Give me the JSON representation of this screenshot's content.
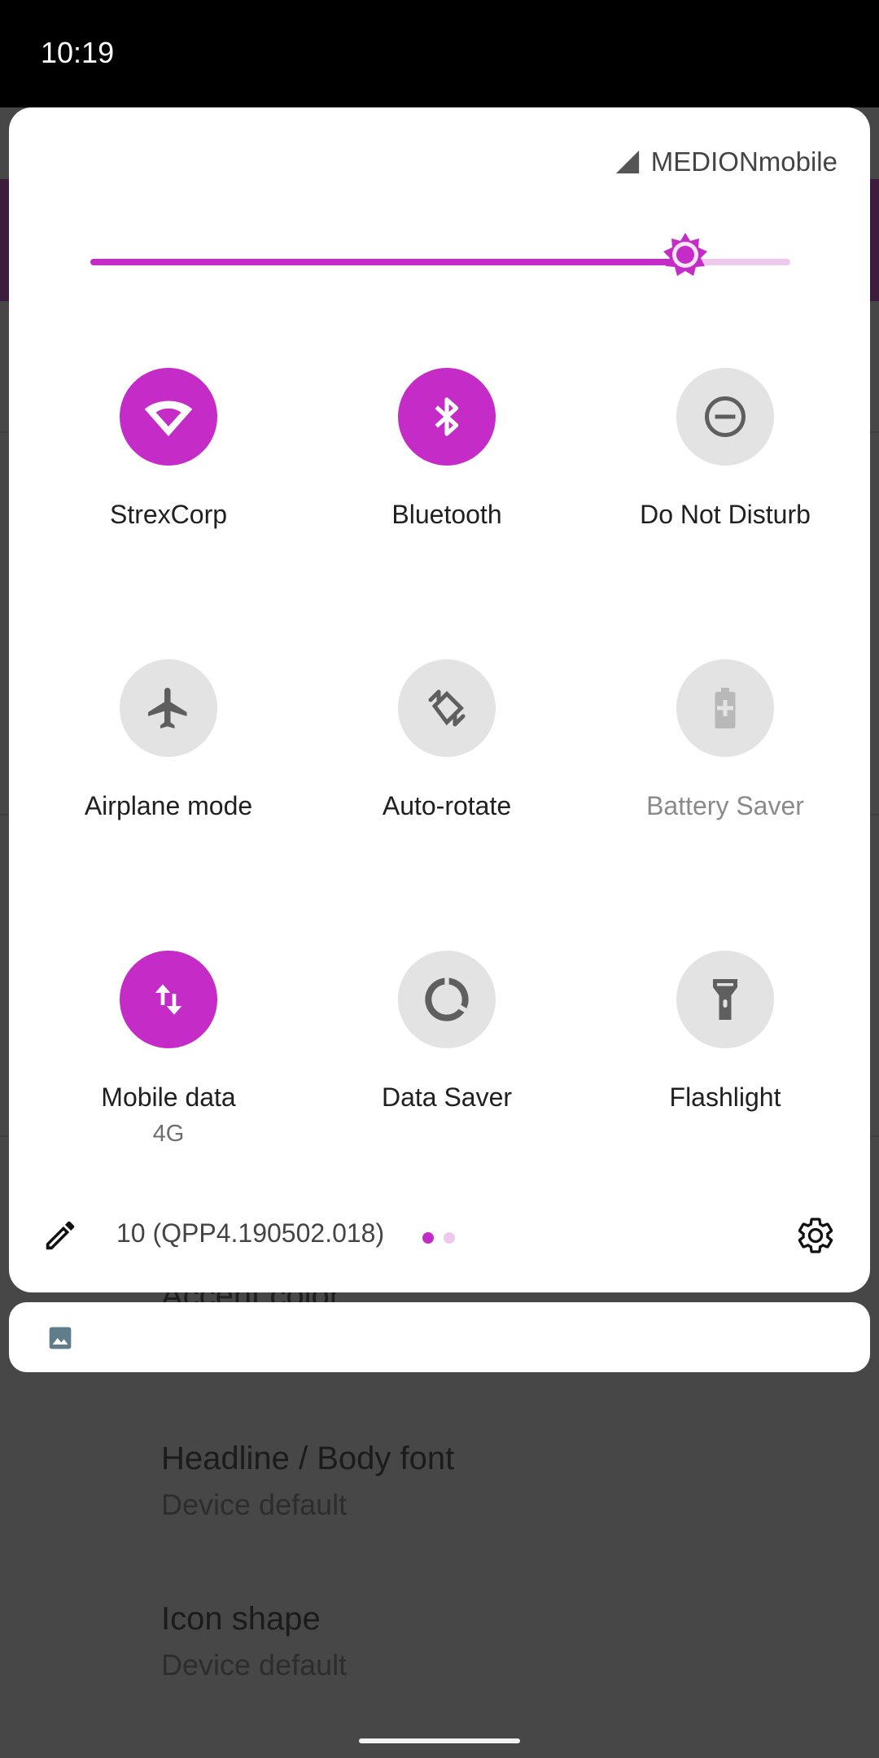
{
  "status_bar": {
    "time": "10:19"
  },
  "quick_settings": {
    "carrier": "MEDIONmobile",
    "brightness_fraction": 0.85,
    "accent_color": "#c42bc7",
    "tiles": [
      {
        "label": "StrexCorp",
        "sub": "",
        "icon": "wifi-icon",
        "state": "on"
      },
      {
        "label": "Bluetooth",
        "sub": "",
        "icon": "bluetooth-icon",
        "state": "on"
      },
      {
        "label": "Do Not Disturb",
        "sub": "",
        "icon": "do-not-disturb-icon",
        "state": "off"
      },
      {
        "label": "Airplane mode",
        "sub": "",
        "icon": "airplane-icon",
        "state": "off"
      },
      {
        "label": "Auto-rotate",
        "sub": "",
        "icon": "auto-rotate-icon",
        "state": "off"
      },
      {
        "label": "Battery Saver",
        "sub": "",
        "icon": "battery-saver-icon",
        "state": "unavailable"
      },
      {
        "label": "Mobile data",
        "sub": "4G",
        "icon": "mobile-data-icon",
        "state": "on"
      },
      {
        "label": "Data Saver",
        "sub": "",
        "icon": "data-saver-icon",
        "state": "off"
      },
      {
        "label": "Flashlight",
        "sub": "",
        "icon": "flashlight-icon",
        "state": "off"
      }
    ],
    "footer": {
      "build": "10 (QPP4.190502.018)",
      "page_count": 2,
      "current_page": 1
    }
  },
  "background": {
    "partial_text": "Accent color",
    "items": [
      {
        "title": "Headline / Body font",
        "subtitle": "Device default"
      },
      {
        "title": "Icon shape",
        "subtitle": "Device default"
      }
    ]
  }
}
